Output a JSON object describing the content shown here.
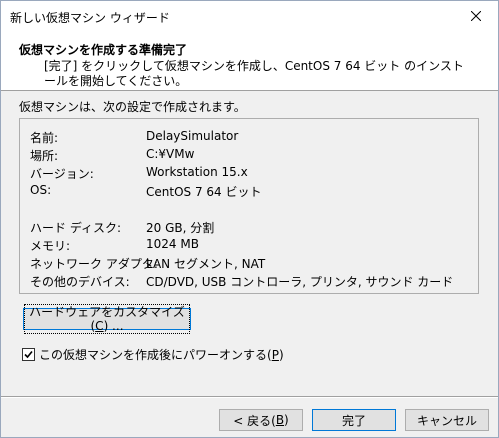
{
  "window": {
    "title": "新しい仮想マシン ウィザード",
    "close_icon": "close-icon"
  },
  "header": {
    "title": "仮想マシンを作成する準備完了",
    "description": "[完了] をクリックして仮想マシンを作成し、CentOS 7 64 ビット のインストールを開始してください。"
  },
  "summary": {
    "label": "仮想マシンは、次の設定で作成されます。",
    "rows": [
      {
        "key": "名前:",
        "value": "DelaySimulator"
      },
      {
        "key": "場所:",
        "value": "C:¥VMw"
      },
      {
        "key": "バージョン:",
        "value": "Workstation 15.x"
      },
      {
        "key": "OS:",
        "value": "CentOS 7 64 ビット"
      },
      {
        "key": "ハード ディスク:",
        "value": "20 GB, 分割"
      },
      {
        "key": "メモリ:",
        "value": "1024 MB"
      },
      {
        "key": "ネットワーク アダプタ:",
        "value": "LAN セグメント, NAT"
      },
      {
        "key": "その他のデバイス:",
        "value": "CD/DVD, USB コントローラ, プリンタ, サウンド カード"
      }
    ]
  },
  "customize": {
    "prefix": "ハードウェアをカスタマイズ(",
    "accel": "C",
    "suffix": ") ..."
  },
  "power_on": {
    "prefix": "この仮想マシンを作成後にパワーオンする(",
    "accel": "P",
    "suffix": ")",
    "checked": true
  },
  "buttons": {
    "back": {
      "prefix": "< 戻る(",
      "accel": "B",
      "suffix": ")"
    },
    "finish": {
      "label": "完了"
    },
    "cancel": {
      "label": "キャンセル"
    }
  }
}
